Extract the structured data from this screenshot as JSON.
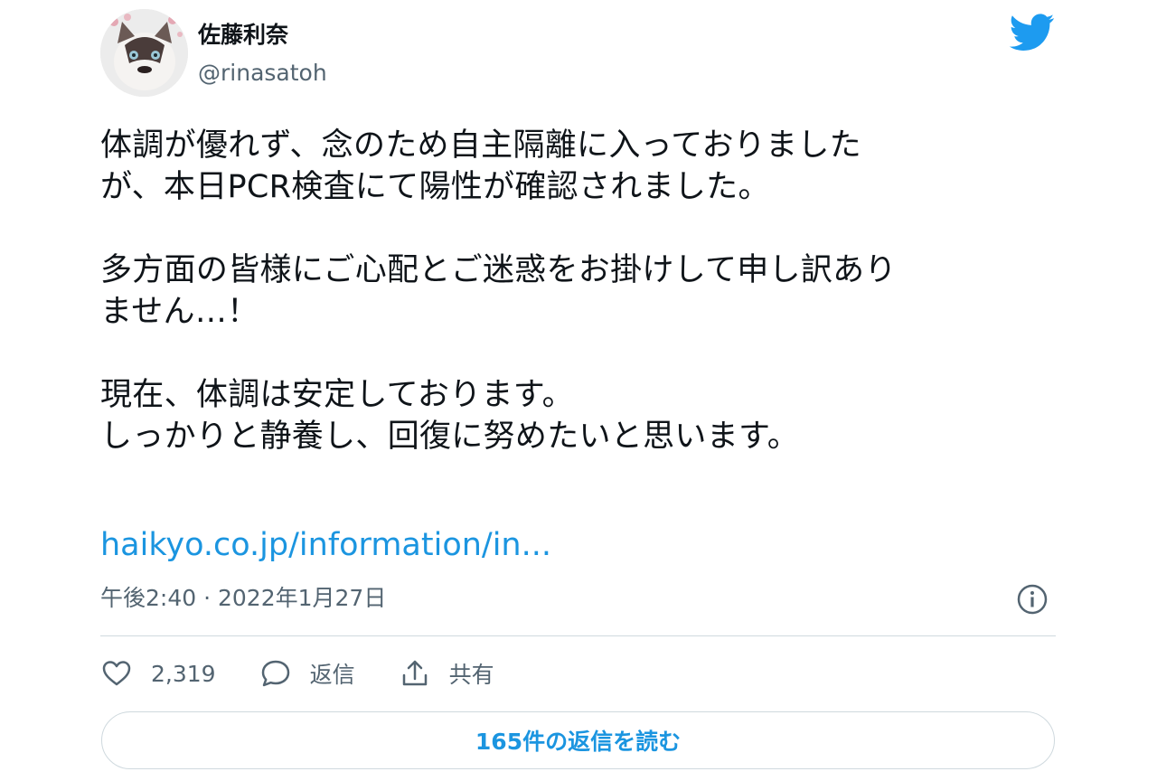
{
  "author": {
    "display_name": "佐藤利奈",
    "handle": "@rinasatoh"
  },
  "tweet": {
    "paragraphs": [
      "体調が優れず、念のため自主隔離に入っておりました\nが、本日PCR検査にて陽性が確認されました。",
      "多方面の皆様にご心配とご迷惑をお掛けして申し訳あり\nません…！",
      "現在、体調は安定しております。\nしっかりと静養し、回復に努めたいと思います。"
    ],
    "link_text": "haikyo.co.jp/information/in...",
    "timestamp": "午後2:40 · 2022年1月27日"
  },
  "actions": {
    "like_count": "2,319",
    "reply_label": "返信",
    "share_label": "共有"
  },
  "read_replies_label": "165件の返信を読む",
  "icons": {
    "brand": "twitter-bird-icon",
    "info": "info-icon",
    "like": "heart-icon",
    "reply": "speech-bubble-icon",
    "share": "share-icon"
  },
  "colors": {
    "accent": "#1d9bf0",
    "link": "#1b95e0",
    "secondary_text": "#536471",
    "divider": "#cfd9de"
  }
}
